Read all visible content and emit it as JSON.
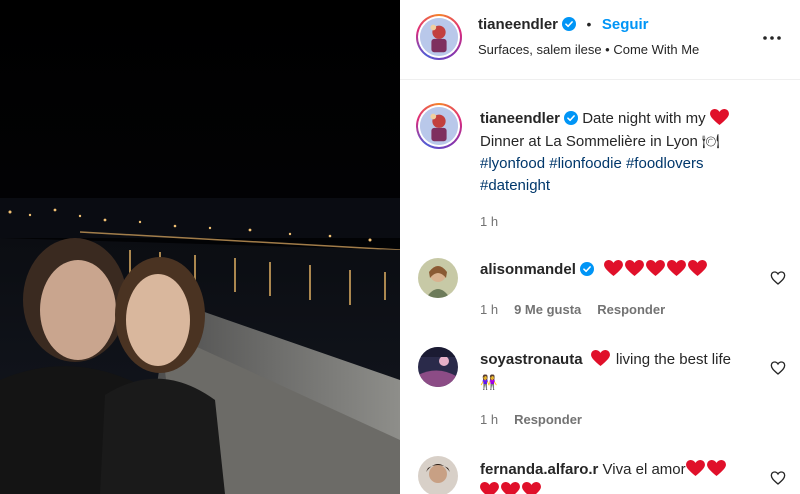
{
  "post": {
    "username": "tianeendler",
    "follow_label": "Seguir",
    "subline": "Surfaces, salem ilese • Come With Me",
    "caption_line1": "Date night with my",
    "caption_line2": "Dinner at La Sommelière in Lyon",
    "hashtags": [
      "#lyonfood",
      "#lionfoodie",
      "#foodlovers",
      "#datenight"
    ],
    "caption_time": "1 h"
  },
  "comments": [
    {
      "username": "alisonmandel",
      "verified": true,
      "text": "",
      "hearts": 5,
      "time": "1 h",
      "likes": "9 Me gusta",
      "reply": "Responder"
    },
    {
      "username": "soyastronauta",
      "verified": false,
      "text": "living the best life",
      "time": "1 h",
      "reply": "Responder"
    },
    {
      "username": "fernanda.alfaro.r",
      "verified": false,
      "text": "Viva el amor"
    }
  ],
  "icons": {
    "verified": "verified-badge-icon",
    "more": "more-options-icon",
    "like": "heart-outline-icon"
  },
  "colors": {
    "accent": "#0095f6",
    "hashtag": "#00376b",
    "muted": "#737373",
    "heart": "#e0102a"
  }
}
